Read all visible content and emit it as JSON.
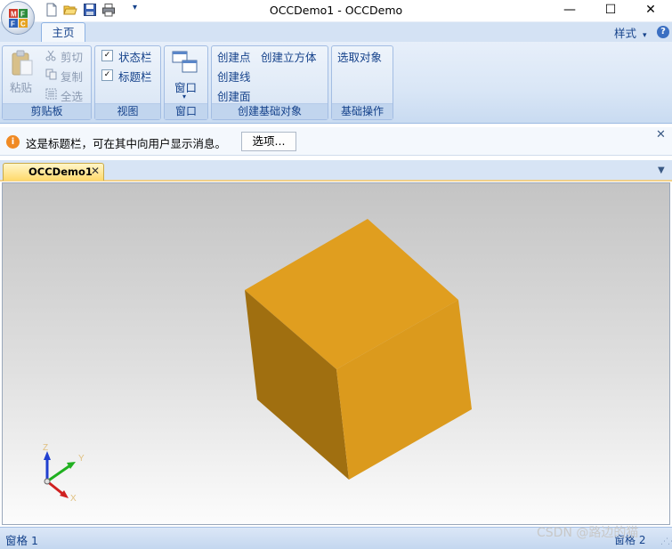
{
  "window": {
    "title": "OCCDemo1 - OCCDemo"
  },
  "window_controls": {
    "minimize": "—",
    "maximize": "☐",
    "close": "✕"
  },
  "qat": {
    "customize_arrow": "▾"
  },
  "ribbon": {
    "tabs": [
      {
        "label": "主页"
      }
    ],
    "style_menu": "样式",
    "style_arrow": "▾",
    "help": "?",
    "groups": {
      "clipboard": {
        "label": "剪贴板",
        "paste": "粘贴",
        "cut": "剪切",
        "copy": "复制",
        "select_all": "全选"
      },
      "view": {
        "label": "视图",
        "statusbar": "状态栏",
        "captionbar": "标题栏"
      },
      "window": {
        "label": "窗口",
        "window_button": "窗口",
        "dropdown": "▾"
      },
      "create": {
        "label": "创建基础对象",
        "point": "创建点",
        "box": "创建立方体",
        "line": "创建线",
        "face": "创建面"
      },
      "basic_ops": {
        "label": "基础操作",
        "select_object": "选取对象"
      }
    }
  },
  "message_bar": {
    "icon": "i",
    "text": "这是标题栏，可在其中向用户显示消息。",
    "options_button": "选项...",
    "close": "✕"
  },
  "document_tabs": [
    {
      "label": "OCCDemo1",
      "close": "✕",
      "active": true
    }
  ],
  "tab_list_arrow": "▼",
  "viewport": {
    "background_top": "#c4c4c4",
    "background_bottom": "#fcfcfc",
    "cube_color": "#e09e1f",
    "axis_labels": {
      "x": "X",
      "y": "Y",
      "z": "Z"
    },
    "axis_colors": {
      "x": "#d02020",
      "y": "#20b020",
      "z": "#2040d0"
    }
  },
  "status_bar": {
    "left": "窗格 1",
    "right": "窗格 2"
  },
  "watermark": "CSDN @路边的猫"
}
